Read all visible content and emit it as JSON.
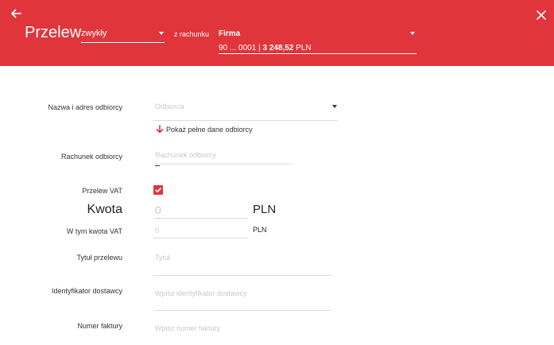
{
  "header": {
    "title": "Przelew",
    "transfer_type": "zwykły",
    "from_label": "z rachunku",
    "account_name": "Firma",
    "account_number": "90 ... 0001",
    "separator": "|",
    "account_balance": "3 248,52",
    "account_currency": "PLN",
    "accent_color": "#e0353b",
    "icons": {
      "back": "arrow-left-icon",
      "close": "close-icon"
    }
  },
  "form": {
    "recipient": {
      "label": "Nazwa i adres odbiorcy",
      "placeholder": "Odbiorca",
      "value": ""
    },
    "show_details": {
      "label": "Pokaż pełne dane odbiorcy",
      "icon": "arrow-down-icon"
    },
    "account": {
      "label": "Rachunek odbiorcy",
      "placeholder": "Rachunek odbiorcy",
      "value": ""
    },
    "vat": {
      "label": "Przelew VAT",
      "checked": true
    },
    "amount": {
      "label": "Kwota",
      "placeholder": "0",
      "currency": "PLN"
    },
    "vat_amount": {
      "label": "W tym kwota VAT",
      "placeholder": "0",
      "currency": "PLN"
    },
    "title": {
      "label": "Tytuł przelewu",
      "placeholder": "Tytuł"
    },
    "supplier_id": {
      "label": "Identyfikator dostawcy",
      "placeholder": "Wpisz identyfikator dostawcy"
    },
    "invoice_number": {
      "label": "Numer faktury",
      "placeholder": "Wpisz numer faktury"
    }
  }
}
